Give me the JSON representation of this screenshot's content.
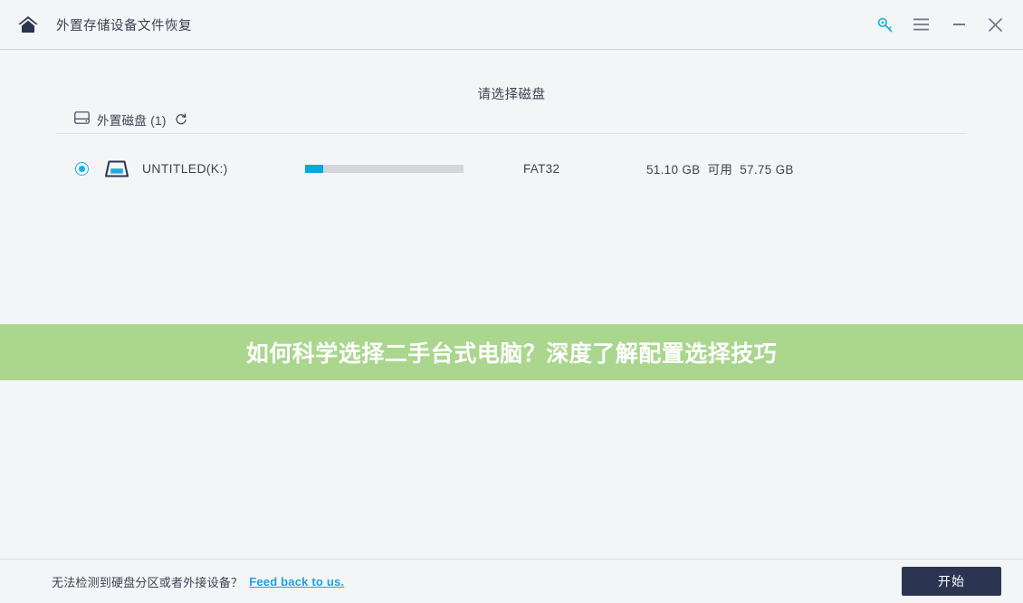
{
  "titlebar": {
    "home_icon": "home-icon",
    "app_title": "外置存储设备文件恢复",
    "key_icon": "key-icon",
    "menu_icon": "hamburger-menu-icon",
    "minimize_icon": "minimize-icon",
    "close_icon": "close-icon"
  },
  "main": {
    "section_title": "请选择磁盘",
    "group": {
      "icon": "hard-disk-icon",
      "label": "外置磁盘 (1)",
      "refresh_icon": "refresh-icon"
    },
    "disk": {
      "selected": true,
      "radio_icon": "radio-selected-icon",
      "icon": "external-drive-icon",
      "name": "UNTITLED(K:)",
      "usage_percent": 11.5,
      "filesystem": "FAT32",
      "used": "51.10 GB",
      "free_label": "可用",
      "free": "57.75 GB",
      "capacity_text": "51.10 GB  可用  57.75 GB"
    }
  },
  "ad_banner": {
    "text": "如何科学选择二手台式电脑？深度了解配置选择技巧",
    "background_color": "#aad68e",
    "text_color": "#ffffff"
  },
  "footer": {
    "note": "无法检测到硬盘分区或者外接设备？",
    "link": "Feed back to us.",
    "link_color": "#1ba3dd",
    "start_label": "开始",
    "start_color": "#2b3552"
  },
  "colors": {
    "accent": "#00a9e0",
    "radio": "#18b0e4",
    "background": "#f4f5f7",
    "dark": "#2b3552"
  }
}
